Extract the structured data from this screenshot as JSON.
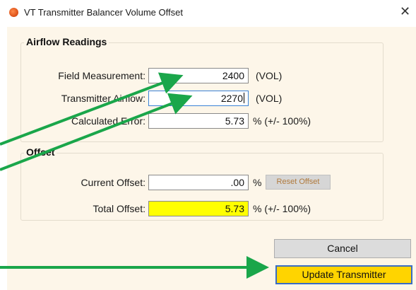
{
  "window": {
    "title": "VT Transmitter Balancer Volume Offset",
    "close_glyph": "✕"
  },
  "airflow": {
    "legend": "Airflow Readings",
    "field_measurement": {
      "label": "Field Measurement:",
      "value": "2400",
      "unit": "(VOL)"
    },
    "transmitter_airflow": {
      "label": "Transmitter Airflow:",
      "value": "2270",
      "unit": "(VOL)"
    },
    "calculated_error": {
      "label": "Calculated Error:",
      "value": "5.73",
      "unit": "%  (+/- 100%)"
    }
  },
  "offset": {
    "legend": "Offset",
    "current_offset": {
      "label": "Current Offset:",
      "value": ".00",
      "unit": "%"
    },
    "reset_button": "Reset Offset",
    "total_offset": {
      "label": "Total Offset:",
      "value": "5.73",
      "unit": "%  (+/- 100%)"
    }
  },
  "buttons": {
    "cancel": "Cancel",
    "update": "Update Transmitter"
  },
  "colors": {
    "arrow": "#1aa64a",
    "highlight": "#ffff00",
    "update_button": "#ffd400",
    "background": "#fdf6e9"
  }
}
